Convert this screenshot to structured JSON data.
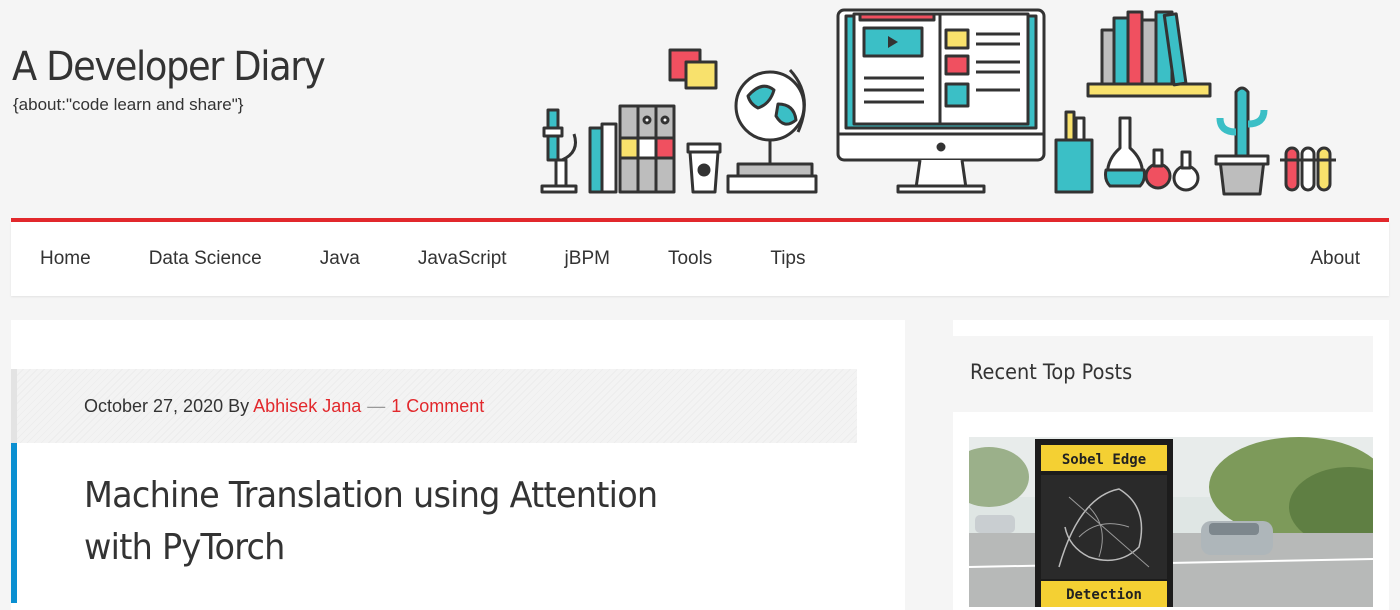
{
  "site": {
    "title": "A Developer Diary",
    "tagline": "{about:\"code learn and share\"}"
  },
  "colors": {
    "accent_red": "#e2282c",
    "accent_blue": "#0a8fd1",
    "teal": "#3bbfc6",
    "yellow": "#f8e16c",
    "pink": "#f05060"
  },
  "nav": {
    "items": [
      {
        "label": "Home"
      },
      {
        "label": "Data Science"
      },
      {
        "label": "Java"
      },
      {
        "label": "JavaScript"
      },
      {
        "label": "jBPM"
      },
      {
        "label": "Tools"
      },
      {
        "label": "Tips"
      }
    ],
    "right_item": {
      "label": "About"
    }
  },
  "post": {
    "date": "October 27, 2020",
    "by": "By",
    "author": "Abhisek Jana",
    "separator": "—",
    "comments": "1 Comment",
    "title": "Machine Translation using Attention with PyTorch"
  },
  "sidebar": {
    "widget_title": "Recent Top Posts",
    "thumbnail": {
      "sign_top": "Sobel Edge",
      "sign_bottom": "Detection"
    }
  },
  "header_illustration": {
    "icons": [
      "microscope-icon",
      "books-icon",
      "coffee-cup-icon",
      "globe-icon",
      "monitor-icon",
      "bookshelf-icon",
      "pencil-cup-icon",
      "flask-icon",
      "cactus-icon",
      "test-tubes-icon"
    ]
  }
}
